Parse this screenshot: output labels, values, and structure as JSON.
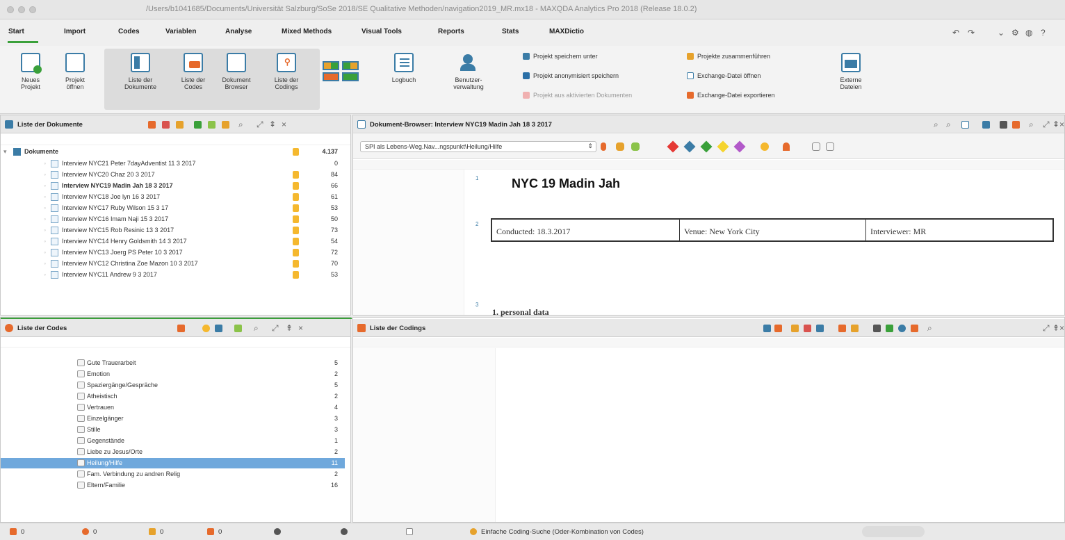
{
  "window": {
    "title": "/Users/b1041685/Documents/Universität Salzburg/SoSe 2018/SE Qualitative Methoden/navigation2019_MR.mx18 - MAXQDA Analytics Pro 2018  (Release 18.0.2)"
  },
  "tabs": [
    "Start",
    "Import",
    "Codes",
    "Variablen",
    "Analyse",
    "Mixed Methods",
    "Visual Tools",
    "Reports",
    "Stats",
    "MAXDictio"
  ],
  "ribbon": {
    "neues_projekt": "Neues\nProjekt",
    "projekt_oeffnen": "Projekt\nöffnen",
    "liste_dokumente": "Liste der\nDokumente",
    "liste_codes": "Liste der\nCodes",
    "dokument_browser": "Dokument\nBrowser",
    "liste_codings": "Liste der\nCodings",
    "logbuch": "Logbuch",
    "benutzerverwaltung": "Benutzer-\nverwaltung",
    "externe_dateien": "Externe\nDateien",
    "small_left": [
      "Projekt speichern unter",
      "Projekt anonymisiert speichern",
      "Projekt aus aktivierten Dokumenten"
    ],
    "small_right": [
      "Projekte zusammenführen",
      "Exchange-Datei öffnen",
      "Exchange-Datei exportieren"
    ]
  },
  "documents_panel": {
    "title": "Liste der Dokumente",
    "root_label": "Dokumente",
    "root_count": "4.137",
    "rows": [
      {
        "label": "Interview NYC21 Peter 7dayAdventist 11 3 2017",
        "count": "0",
        "marker": false,
        "bold": false
      },
      {
        "label": "Interview NYC20 Chaz 20 3 2017",
        "count": "84",
        "marker": true,
        "bold": false
      },
      {
        "label": "Interview NYC19 Madin Jah 18 3 2017",
        "count": "66",
        "marker": true,
        "bold": true
      },
      {
        "label": "Interview NYC18 Joe lyn 16 3 2017",
        "count": "61",
        "marker": true,
        "bold": false
      },
      {
        "label": "Interview NYC17 Ruby Wilson 15 3 17",
        "count": "53",
        "marker": true,
        "bold": false
      },
      {
        "label": "Interview NYC16 Imam Naji 15 3 2017",
        "count": "50",
        "marker": true,
        "bold": false
      },
      {
        "label": "Interview NYC15 Rob Resinic 13 3 2017",
        "count": "73",
        "marker": true,
        "bold": false
      },
      {
        "label": "Interview NYC14 Henry Goldsmith 14 3 2017",
        "count": "54",
        "marker": true,
        "bold": false
      },
      {
        "label": "Interview NYC13 Joerg PS Peter 10 3 2017",
        "count": "72",
        "marker": true,
        "bold": false
      },
      {
        "label": "Interview NYC12 Christina Zoe Mazon 10 3 2017",
        "count": "70",
        "marker": true,
        "bold": false
      },
      {
        "label": "Interview NYC11 Andrew 9 3 2017",
        "count": "53",
        "marker": true,
        "bold": false
      }
    ]
  },
  "browser_panel": {
    "title": "Dokument-Browser: Interview NYC19 Madin Jah 18 3 2017",
    "code_select": "SPI als Lebens-Weg.Nav...ngspunkt\\Heilung/Hilfe",
    "heading": "NYC 19 Madin Jah",
    "table_cells": [
      "Conducted: 18.3.2017",
      "Venue: New York City",
      "Interviewer: MR"
    ],
    "section": "1. personal data",
    "para_numbers": [
      "1",
      "2",
      "3"
    ]
  },
  "codes_panel": {
    "title": "Liste der Codes",
    "rows": [
      {
        "label": "Gute Trauerarbeit",
        "count": "5",
        "selected": false
      },
      {
        "label": "Emotion",
        "count": "2",
        "selected": false
      },
      {
        "label": "Spaziergänge/Gespräche",
        "count": "5",
        "selected": false
      },
      {
        "label": "Atheistisch",
        "count": "2",
        "selected": false
      },
      {
        "label": "Vertrauen",
        "count": "4",
        "selected": false
      },
      {
        "label": "Einzelgänger",
        "count": "3",
        "selected": false
      },
      {
        "label": "Stille",
        "count": "3",
        "selected": false
      },
      {
        "label": "Gegenstände",
        "count": "1",
        "selected": false
      },
      {
        "label": "Liebe zu Jesus/Orte",
        "count": "2",
        "selected": false
      },
      {
        "label": "Heilung/Hilfe",
        "count": "11",
        "selected": true
      },
      {
        "label": "Fam. Verbindung zu andren Relig",
        "count": "2",
        "selected": false
      },
      {
        "label": "Eltern/Familie",
        "count": "16",
        "selected": false
      }
    ]
  },
  "codings_panel": {
    "title": "Liste der Codings"
  },
  "statusbar": {
    "items": [
      "0",
      "0",
      "0",
      "0"
    ],
    "search_text": "Einfache Coding-Suche (Oder-Kombination von Codes)"
  },
  "colors": {
    "accent_green": "#3aa03a",
    "marker_orange": "#f5b82e",
    "selection_blue": "#6fa8dc"
  }
}
